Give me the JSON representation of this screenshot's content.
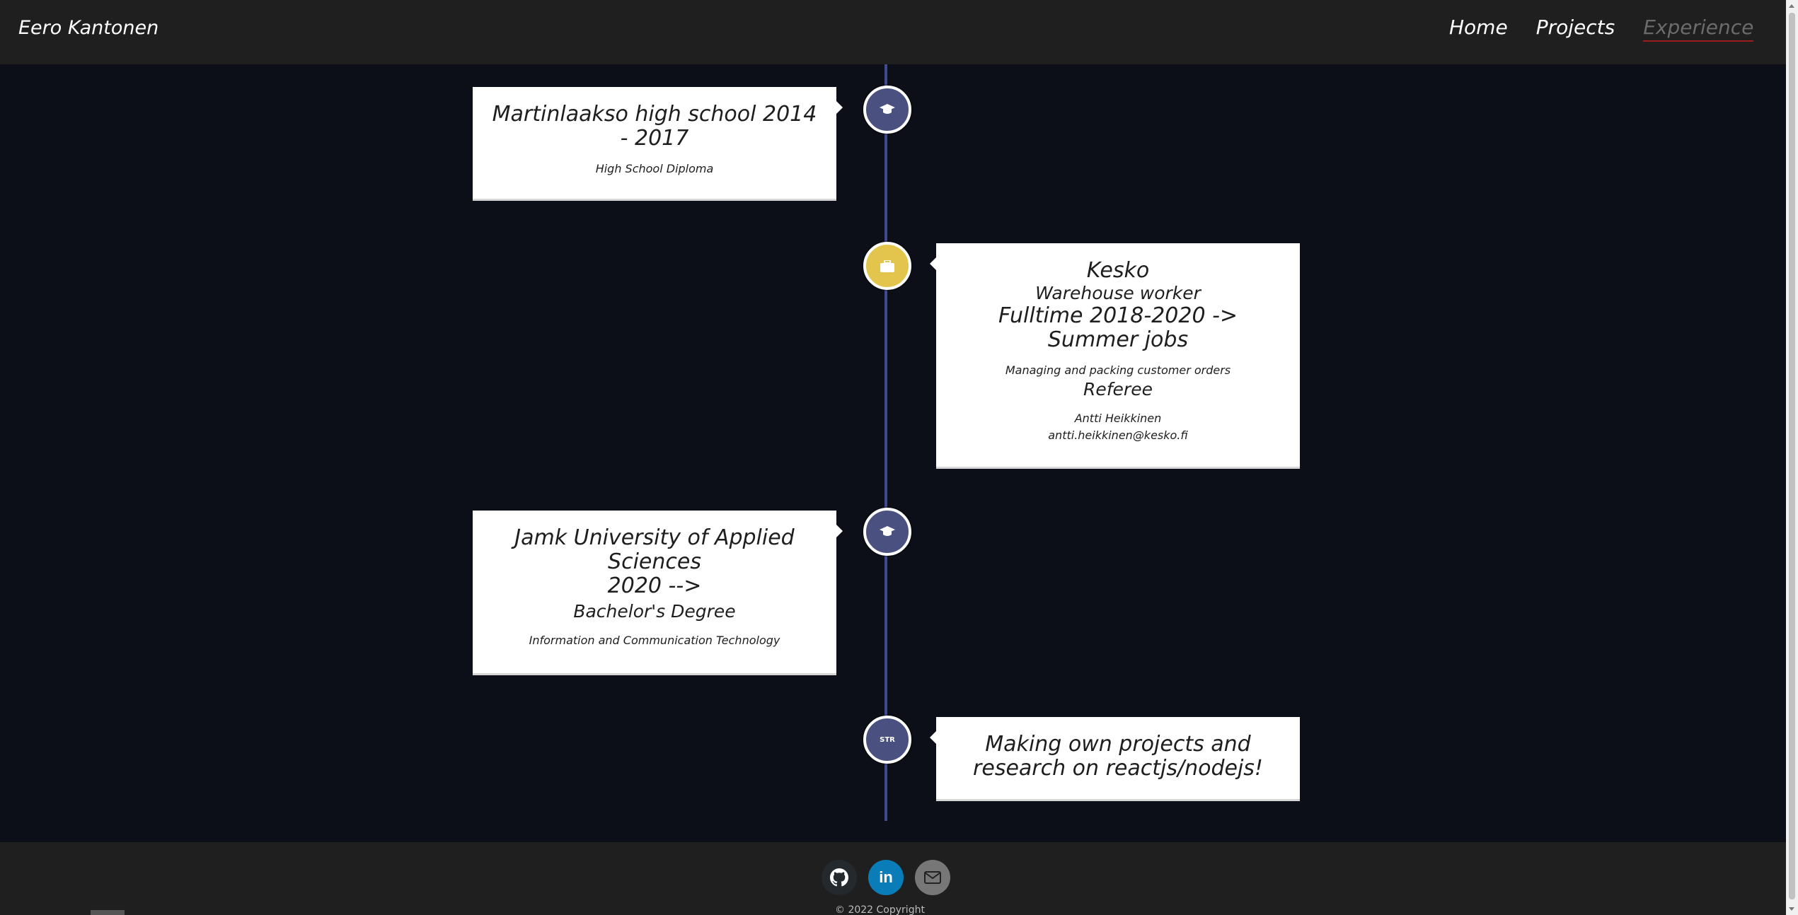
{
  "header": {
    "brand": "Eero Kantonen",
    "nav": [
      {
        "label": "Home"
      },
      {
        "label": "Projects"
      },
      {
        "label": "Experience"
      }
    ]
  },
  "timeline": {
    "items": [
      {
        "icon": "graduation-cap-icon",
        "title": "Martinlaakso high school 2014 - 2017",
        "detail": "High School Diploma"
      },
      {
        "icon": "briefcase-icon",
        "title": "Kesko",
        "role": "Warehouse worker",
        "period": "Fulltime 2018-2020 -> Summer jobs",
        "detail": "Managing and packing customer orders",
        "role2": "Referee",
        "contact_name": "Antti Heikkinen",
        "contact_email": "antti.heikkinen@kesko.fi"
      },
      {
        "icon": "graduation-cap-icon",
        "title": "Jamk University of Applied Sciences",
        "period": "2020 -->",
        "degree": "Bachelor's Degree",
        "detail": "Information and Communication Technology"
      },
      {
        "icon": "star-icon",
        "icon_text": "STR",
        "title": "Making own projects and research on reactjs/nodejs!"
      }
    ]
  },
  "footer": {
    "social": [
      {
        "icon": "github-icon"
      },
      {
        "icon": "linkedin-icon",
        "text": "in"
      },
      {
        "icon": "email-icon"
      }
    ],
    "copyright": "© 2022 Copyright"
  },
  "colors": {
    "background": "#0c0f17",
    "header": "#1f1f1f",
    "timeline_line": "#3f4b8f",
    "education_node": "#4a5080",
    "work_node": "#e3c44d",
    "active_underline": "#9b1c1c"
  }
}
